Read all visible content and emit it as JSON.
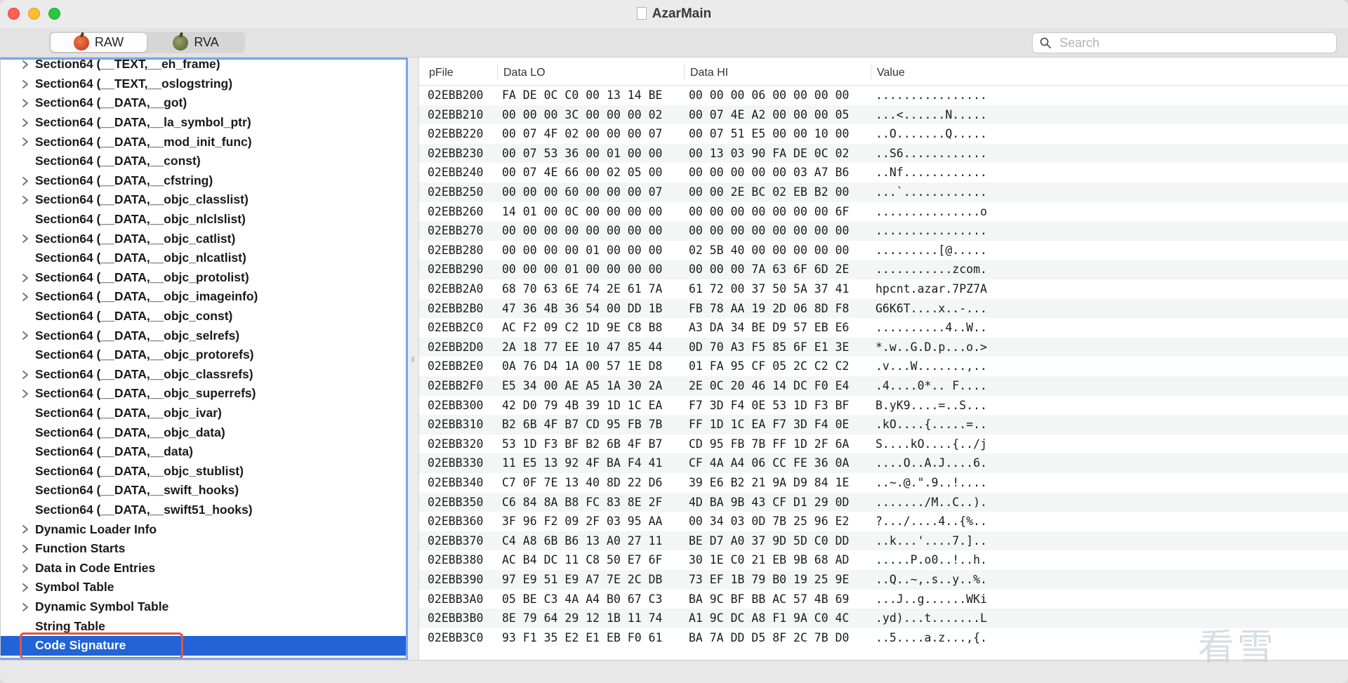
{
  "window": {
    "title": "AzarMain"
  },
  "toolbar": {
    "raw_label": "RAW",
    "rva_label": "RVA",
    "search_placeholder": "Search"
  },
  "tree": {
    "items": [
      {
        "label": "Section64 (__TEXT,__eh_frame)",
        "expandable": true
      },
      {
        "label": "Section64 (__TEXT,__oslogstring)",
        "expandable": true
      },
      {
        "label": "Section64 (__DATA,__got)",
        "expandable": true
      },
      {
        "label": "Section64 (__DATA,__la_symbol_ptr)",
        "expandable": true
      },
      {
        "label": "Section64 (__DATA,__mod_init_func)",
        "expandable": true
      },
      {
        "label": "Section64 (__DATA,__const)",
        "expandable": false
      },
      {
        "label": "Section64 (__DATA,__cfstring)",
        "expandable": true
      },
      {
        "label": "Section64 (__DATA,__objc_classlist)",
        "expandable": true
      },
      {
        "label": "Section64 (__DATA,__objc_nlclslist)",
        "expandable": false
      },
      {
        "label": "Section64 (__DATA,__objc_catlist)",
        "expandable": true
      },
      {
        "label": "Section64 (__DATA,__objc_nlcatlist)",
        "expandable": false
      },
      {
        "label": "Section64 (__DATA,__objc_protolist)",
        "expandable": true
      },
      {
        "label": "Section64 (__DATA,__objc_imageinfo)",
        "expandable": true
      },
      {
        "label": "Section64 (__DATA,__objc_const)",
        "expandable": false
      },
      {
        "label": "Section64 (__DATA,__objc_selrefs)",
        "expandable": true
      },
      {
        "label": "Section64 (__DATA,__objc_protorefs)",
        "expandable": false
      },
      {
        "label": "Section64 (__DATA,__objc_classrefs)",
        "expandable": true
      },
      {
        "label": "Section64 (__DATA,__objc_superrefs)",
        "expandable": true
      },
      {
        "label": "Section64 (__DATA,__objc_ivar)",
        "expandable": false
      },
      {
        "label": "Section64 (__DATA,__objc_data)",
        "expandable": false
      },
      {
        "label": "Section64 (__DATA,__data)",
        "expandable": false
      },
      {
        "label": "Section64 (__DATA,__objc_stublist)",
        "expandable": false
      },
      {
        "label": "Section64 (__DATA,__swift_hooks)",
        "expandable": false
      },
      {
        "label": "Section64 (__DATA,__swift51_hooks)",
        "expandable": false
      },
      {
        "label": "Dynamic Loader Info",
        "expandable": true
      },
      {
        "label": "Function Starts",
        "expandable": true
      },
      {
        "label": "Data in Code Entries",
        "expandable": true
      },
      {
        "label": "Symbol Table",
        "expandable": true
      },
      {
        "label": "Dynamic Symbol Table",
        "expandable": true
      },
      {
        "label": "String Table",
        "expandable": false
      },
      {
        "label": "Code Signature",
        "expandable": false,
        "selected": true
      }
    ]
  },
  "hex_table": {
    "columns": [
      "pFile",
      "Data LO",
      "Data HI",
      "Value"
    ],
    "rows": [
      [
        "02EBB200",
        "FA DE 0C C0 00 13 14 BE",
        "00 00 00 06 00 00 00 00",
        "................"
      ],
      [
        "02EBB210",
        "00 00 00 3C 00 00 00 02",
        "00 07 4E A2 00 00 00 05",
        "...<......N....."
      ],
      [
        "02EBB220",
        "00 07 4F 02 00 00 00 07",
        "00 07 51 E5 00 00 10 00",
        "..O.......Q....."
      ],
      [
        "02EBB230",
        "00 07 53 36 00 01 00 00",
        "00 13 03 90 FA DE 0C 02",
        "..S6............"
      ],
      [
        "02EBB240",
        "00 07 4E 66 00 02 05 00",
        "00 00 00 00 00 03 A7 B6",
        "..Nf............"
      ],
      [
        "02EBB250",
        "00 00 00 60 00 00 00 07",
        "00 00 2E BC 02 EB B2 00",
        "...`............"
      ],
      [
        "02EBB260",
        "14 01 00 0C 00 00 00 00",
        "00 00 00 00 00 00 00 6F",
        "...............o"
      ],
      [
        "02EBB270",
        "00 00 00 00 00 00 00 00",
        "00 00 00 00 00 00 00 00",
        "................"
      ],
      [
        "02EBB280",
        "00 00 00 00 01 00 00 00",
        "02 5B 40 00 00 00 00 00",
        ".........[@....."
      ],
      [
        "02EBB290",
        "00 00 00 01 00 00 00 00",
        "00 00 00 7A 63 6F 6D 2E",
        "...........zcom."
      ],
      [
        "02EBB2A0",
        "68 70 63 6E 74 2E 61 7A",
        "61 72 00 37 50 5A 37 41",
        "hpcnt.azar.7PZ7A"
      ],
      [
        "02EBB2B0",
        "47 36 4B 36 54 00 DD 1B",
        "FB 78 AA 19 2D 06 8D F8",
        "G6K6T....x..-..."
      ],
      [
        "02EBB2C0",
        "AC F2 09 C2 1D 9E C8 B8",
        "A3 DA 34 BE D9 57 EB E6",
        "..........4..W.."
      ],
      [
        "02EBB2D0",
        "2A 18 77 EE 10 47 85 44",
        "0D 70 A3 F5 85 6F E1 3E",
        "*.w..G.D.p...o.>"
      ],
      [
        "02EBB2E0",
        "0A 76 D4 1A 00 57 1E D8",
        "01 FA 95 CF 05 2C C2 C2",
        ".v...W.......,.."
      ],
      [
        "02EBB2F0",
        "E5 34 00 AE A5 1A 30 2A",
        "2E 0C 20 46 14 DC F0 E4",
        ".4....0*.. F...."
      ],
      [
        "02EBB300",
        "42 D0 79 4B 39 1D 1C EA",
        "F7 3D F4 0E 53 1D F3 BF",
        "B.yK9....=..S..."
      ],
      [
        "02EBB310",
        "B2 6B 4F B7 CD 95 FB 7B",
        "FF 1D 1C EA F7 3D F4 0E",
        ".kO....{.....=.."
      ],
      [
        "02EBB320",
        "53 1D F3 BF B2 6B 4F B7",
        "CD 95 FB 7B FF 1D 2F 6A",
        "S....kO....{../j"
      ],
      [
        "02EBB330",
        "11 E5 13 92 4F BA F4 41",
        "CF 4A A4 06 CC FE 36 0A",
        "....O..A.J....6."
      ],
      [
        "02EBB340",
        "C7 0F 7E 13 40 8D 22 D6",
        "39 E6 B2 21 9A D9 84 1E",
        "..~.@.\".9..!...."
      ],
      [
        "02EBB350",
        "C6 84 8A B8 FC 83 8E 2F",
        "4D BA 9B 43 CF D1 29 0D",
        "......./M..C..)."
      ],
      [
        "02EBB360",
        "3F 96 F2 09 2F 03 95 AA",
        "00 34 03 0D 7B 25 96 E2",
        "?.../....4..{%.."
      ],
      [
        "02EBB370",
        "C4 A8 6B B6 13 A0 27 11",
        "BE D7 A0 37 9D 5D C0 DD",
        "..k...'....7.].."
      ],
      [
        "02EBB380",
        "AC B4 DC 11 C8 50 E7 6F",
        "30 1E C0 21 EB 9B 68 AD",
        ".....P.o0..!..h."
      ],
      [
        "02EBB390",
        "97 E9 51 E9 A7 7E 2C DB",
        "73 EF 1B 79 B0 19 25 9E",
        "..Q..~,.s..y..%."
      ],
      [
        "02EBB3A0",
        "05 BE C3 4A A4 B0 67 C3",
        "BA 9C BF BB AC 57 4B 69",
        "...J..g......WKi"
      ],
      [
        "02EBB3B0",
        "8E 79 64 29 12 1B 11 74",
        "A1 9C DC A8 F1 9A C0 4C",
        ".yd)...t.......L"
      ],
      [
        "02EBB3C0",
        "93 F1 35 E2 E1 EB F0 61",
        "BA 7A DD D5 8F 2C 7B D0",
        "..5....a.z...,{."
      ]
    ]
  },
  "watermark": {
    "text": "看雪"
  },
  "colors": {
    "selection": "#2263d6",
    "focus_ring": "#e5543a",
    "tree_focus_border": "#7ca4ea"
  }
}
